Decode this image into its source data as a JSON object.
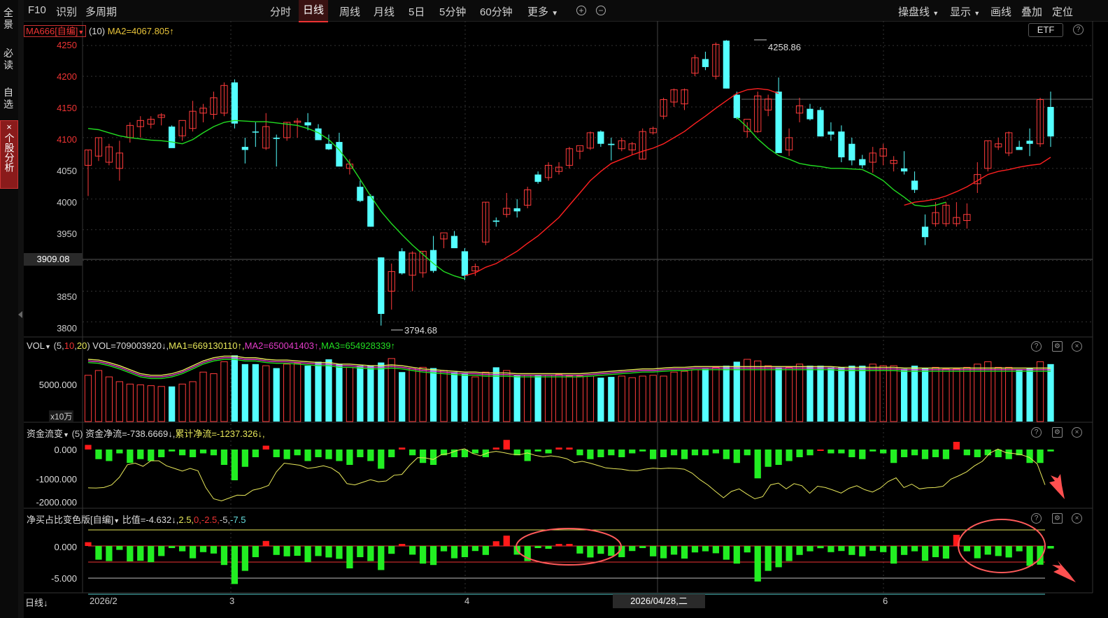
{
  "sidebar": {
    "items": [
      {
        "label": "全景"
      },
      {
        "label": "必读"
      },
      {
        "label": "自选"
      },
      {
        "label": "个股分析",
        "close": "×"
      }
    ]
  },
  "topbar": {
    "left_tabs": [
      "F10",
      "识别",
      "多周期"
    ],
    "period_tabs": [
      "分时",
      "日线",
      "周线",
      "月线",
      "5日",
      "5分钟",
      "60分钟",
      "更多"
    ],
    "active_period": "日线",
    "zoom_in": "+",
    "zoom_out": "−",
    "right_menu": [
      "操盘线",
      "显示",
      "画线",
      "叠加",
      "定位"
    ]
  },
  "main_panel": {
    "indicator_select": "MA666[自编]",
    "indicator_param": "(10)",
    "ma2_label": "MA2=4067.805↑",
    "etf_button": "ETF",
    "help": "?",
    "high_label": "4258.86",
    "low_label": "3794.68",
    "crosshair_price": "3909.08",
    "y_ticks": [
      "4250",
      "4200",
      "4150",
      "4100",
      "4050",
      "4000",
      "3950",
      "3850",
      "3800"
    ]
  },
  "vol_panel": {
    "title": "VOL",
    "params_open": "(",
    "p1": "5",
    ",": ",",
    "p2": "10",
    "p3": "20",
    "params_close": ")",
    "vol": "VOL=709003920↓,",
    "ma1": "MA1=669130110↑,",
    "ma2": "MA2=650041403↑,",
    "ma3": "MA3=654928339↑",
    "y_tick": "5000.000",
    "unit": "x10万"
  },
  "flow_panel": {
    "title": "资金流变",
    "param": "(5)",
    "net": "资金净流=-738.6669↓,",
    "cum": "累计净流=-1237.326↓,",
    "y_ticks": [
      "0.000",
      "-1000.000",
      "-2000.000"
    ]
  },
  "ratio_panel": {
    "title": "净买占比变色版[自编]",
    "ratio": "比值=-4.632↓,",
    "l1": "2.5,",
    "l2": "0,",
    "l3": "-2.5,",
    "l4": "-5,",
    "l5": "-7.5",
    "y_ticks": [
      "0.000",
      "-5.000"
    ]
  },
  "footer": {
    "period": "日线↓",
    "x_labels": [
      "2026/2",
      "3",
      "4",
      "6"
    ],
    "crosshair_date": "2026/04/28,二"
  },
  "colors": {
    "up": "#ff3b3b",
    "down": "#54ffff",
    "ma_green": "#22dd22",
    "ma_red": "#ff2020",
    "flow_pos": "#ff1a1a",
    "flow_neg": "#22ee22",
    "yellow": "#e8e85a"
  },
  "chart_data": {
    "type": "candlestick",
    "ylim": [
      3780,
      4265
    ],
    "candles": [
      {
        "o": 4055,
        "h": 4080,
        "l": 4005,
        "c": 4080
      },
      {
        "o": 4070,
        "h": 4100,
        "l": 4062,
        "c": 4100
      },
      {
        "o": 4060,
        "h": 4090,
        "l": 4055,
        "c": 4085
      },
      {
        "o": 4050,
        "h": 4095,
        "l": 4030,
        "c": 4075
      },
      {
        "o": 4100,
        "h": 4125,
        "l": 4092,
        "c": 4120
      },
      {
        "o": 4118,
        "h": 4135,
        "l": 4100,
        "c": 4128
      },
      {
        "o": 4122,
        "h": 4135,
        "l": 4115,
        "c": 4130
      },
      {
        "o": 4133,
        "h": 4140,
        "l": 4120,
        "c": 4137
      },
      {
        "o": 4118,
        "h": 4120,
        "l": 4090,
        "c": 4083
      },
      {
        "o": 4103,
        "h": 4118,
        "l": 4095,
        "c": 4128
      },
      {
        "o": 4115,
        "h": 4160,
        "l": 4110,
        "c": 4143
      },
      {
        "o": 4140,
        "h": 4155,
        "l": 4125,
        "c": 4148
      },
      {
        "o": 4138,
        "h": 4175,
        "l": 4130,
        "c": 4165
      },
      {
        "o": 4140,
        "h": 4190,
        "l": 4135,
        "c": 4185
      },
      {
        "o": 4190,
        "h": 4195,
        "l": 4115,
        "c": 4123
      },
      {
        "o": 4085,
        "h": 4100,
        "l": 4058,
        "c": 4080
      },
      {
        "o": 4110,
        "h": 4125,
        "l": 4085,
        "c": 4109
      },
      {
        "o": 4083,
        "h": 4140,
        "l": 4080,
        "c": 4118
      },
      {
        "o": 4100,
        "h": 4105,
        "l": 4053,
        "c": 4098
      },
      {
        "o": 4100,
        "h": 4125,
        "l": 4095,
        "c": 4125
      },
      {
        "o": 4125,
        "h": 4132,
        "l": 4100,
        "c": 4127
      },
      {
        "o": 4125,
        "h": 4140,
        "l": 4112,
        "c": 4120
      },
      {
        "o": 4115,
        "h": 4122,
        "l": 4100,
        "c": 4096
      },
      {
        "o": 4090,
        "h": 4105,
        "l": 4080,
        "c": 4081
      },
      {
        "o": 4093,
        "h": 4108,
        "l": 4055,
        "c": 4053
      },
      {
        "o": 4050,
        "h": 4065,
        "l": 4040,
        "c": 4057
      },
      {
        "o": 4020,
        "h": 4030,
        "l": 3995,
        "c": 3997
      },
      {
        "o": 4005,
        "h": 4008,
        "l": 3955,
        "c": 3955
      },
      {
        "o": 3905,
        "h": 3905,
        "l": 3794,
        "c": 3813
      },
      {
        "o": 3850,
        "h": 3895,
        "l": 3820,
        "c": 3882
      },
      {
        "o": 3915,
        "h": 3920,
        "l": 3877,
        "c": 3879
      },
      {
        "o": 3876,
        "h": 3915,
        "l": 3850,
        "c": 3912
      },
      {
        "o": 3880,
        "h": 3915,
        "l": 3872,
        "c": 3915
      },
      {
        "o": 3917,
        "h": 3940,
        "l": 3880,
        "c": 3883
      },
      {
        "o": 3935,
        "h": 3942,
        "l": 3920,
        "c": 3945
      },
      {
        "o": 3940,
        "h": 3948,
        "l": 3920,
        "c": 3920
      },
      {
        "o": 3915,
        "h": 3920,
        "l": 3868,
        "c": 3875
      },
      {
        "o": 3883,
        "h": 3895,
        "l": 3875,
        "c": 3890
      },
      {
        "o": 3930,
        "h": 3995,
        "l": 3925,
        "c": 3995
      },
      {
        "o": 3965,
        "h": 3970,
        "l": 3955,
        "c": 3963
      },
      {
        "o": 3975,
        "h": 4010,
        "l": 3970,
        "c": 3985
      },
      {
        "o": 3985,
        "h": 4000,
        "l": 3970,
        "c": 3980
      },
      {
        "o": 3990,
        "h": 4020,
        "l": 3985,
        "c": 4015
      },
      {
        "o": 4040,
        "h": 4045,
        "l": 4025,
        "c": 4028
      },
      {
        "o": 4035,
        "h": 4060,
        "l": 4030,
        "c": 4055
      },
      {
        "o": 4045,
        "h": 4060,
        "l": 4040,
        "c": 4052
      },
      {
        "o": 4055,
        "h": 4085,
        "l": 4050,
        "c": 4082
      },
      {
        "o": 4078,
        "h": 4085,
        "l": 4065,
        "c": 4087
      },
      {
        "o": 4083,
        "h": 4110,
        "l": 4080,
        "c": 4108
      },
      {
        "o": 4110,
        "h": 4112,
        "l": 4085,
        "c": 4090
      },
      {
        "o": 4090,
        "h": 4100,
        "l": 4063,
        "c": 4088
      },
      {
        "o": 4082,
        "h": 4100,
        "l": 4078,
        "c": 4095
      },
      {
        "o": 4080,
        "h": 4093,
        "l": 4072,
        "c": 4090
      },
      {
        "o": 4065,
        "h": 4115,
        "l": 4065,
        "c": 4110
      },
      {
        "o": 4108,
        "h": 4118,
        "l": 4105,
        "c": 4115
      },
      {
        "o": 4135,
        "h": 4165,
        "l": 4130,
        "c": 4162
      },
      {
        "o": 4158,
        "h": 4180,
        "l": 4150,
        "c": 4178
      },
      {
        "o": 4155,
        "h": 4180,
        "l": 4145,
        "c": 4178
      },
      {
        "o": 4205,
        "h": 4235,
        "l": 4200,
        "c": 4230
      },
      {
        "o": 4228,
        "h": 4240,
        "l": 4210,
        "c": 4215
      },
      {
        "o": 4200,
        "h": 4255,
        "l": 4195,
        "c": 4252
      },
      {
        "o": 4258,
        "h": 4259,
        "l": 4180,
        "c": 4180
      },
      {
        "o": 4170,
        "h": 4175,
        "l": 4130,
        "c": 4132
      },
      {
        "o": 4110,
        "h": 4125,
        "l": 4100,
        "c": 4130
      },
      {
        "o": 4110,
        "h": 4175,
        "l": 4108,
        "c": 4168
      },
      {
        "o": 4145,
        "h": 4170,
        "l": 4135,
        "c": 4163
      },
      {
        "o": 4175,
        "h": 4198,
        "l": 4075,
        "c": 4075
      },
      {
        "o": 4080,
        "h": 4115,
        "l": 4070,
        "c": 4100
      },
      {
        "o": 4140,
        "h": 4165,
        "l": 4125,
        "c": 4152
      },
      {
        "o": 4147,
        "h": 4155,
        "l": 4128,
        "c": 4130
      },
      {
        "o": 4145,
        "h": 4150,
        "l": 4102,
        "c": 4102
      },
      {
        "o": 4110,
        "h": 4125,
        "l": 4095,
        "c": 4105
      },
      {
        "o": 4110,
        "h": 4120,
        "l": 4060,
        "c": 4068
      },
      {
        "o": 4090,
        "h": 4100,
        "l": 4055,
        "c": 4063
      },
      {
        "o": 4065,
        "h": 4072,
        "l": 4050,
        "c": 4055
      },
      {
        "o": 4060,
        "h": 4085,
        "l": 4043,
        "c": 4075
      },
      {
        "o": 4070,
        "h": 4090,
        "l": 4055,
        "c": 4082
      },
      {
        "o": 4058,
        "h": 4070,
        "l": 4045,
        "c": 4063
      },
      {
        "o": 4050,
        "h": 4078,
        "l": 4040,
        "c": 4045
      },
      {
        "o": 4030,
        "h": 4045,
        "l": 4010,
        "c": 4015
      },
      {
        "o": 3955,
        "h": 3975,
        "l": 3925,
        "c": 3938
      },
      {
        "o": 3960,
        "h": 3995,
        "l": 3955,
        "c": 3978
      },
      {
        "o": 3960,
        "h": 3995,
        "l": 3955,
        "c": 3990
      },
      {
        "o": 3960,
        "h": 3995,
        "l": 3955,
        "c": 3970
      },
      {
        "o": 3965,
        "h": 3993,
        "l": 3952,
        "c": 3975
      },
      {
        "o": 4025,
        "h": 4060,
        "l": 4010,
        "c": 4040
      },
      {
        "o": 4050,
        "h": 4095,
        "l": 4045,
        "c": 4095
      },
      {
        "o": 4085,
        "h": 4100,
        "l": 4080,
        "c": 4090
      },
      {
        "o": 4075,
        "h": 4110,
        "l": 4070,
        "c": 4108
      },
      {
        "o": 4085,
        "h": 4095,
        "l": 4080,
        "c": 4080
      },
      {
        "o": 4095,
        "h": 4115,
        "l": 4070,
        "c": 4090
      },
      {
        "o": 4090,
        "h": 4165,
        "l": 4085,
        "c": 4162
      },
      {
        "o": 4150,
        "h": 4175,
        "l": 4085,
        "c": 4102
      }
    ],
    "ma_green": [
      4115,
      4113,
      4108,
      4103,
      4100,
      4098,
      4096,
      4095,
      4093,
      4090,
      4097,
      4108,
      4118,
      4125,
      4128,
      4127,
      4126,
      4126,
      4124,
      4122,
      4120,
      4115,
      4108,
      4097,
      4080,
      4058,
      4032,
      4005,
      3980,
      3960,
      3942,
      3925,
      3910,
      3895,
      3882,
      3875,
      3870
    ],
    "ma_green2": [
      4133,
      4117,
      4098,
      4083,
      4071,
      4065,
      4058,
      4055,
      4053,
      4050,
      4050,
      4049,
      4048,
      4040,
      4030,
      4015,
      4003,
      3990,
      3988,
      3990,
      3995
    ],
    "ma_red": [
      4070,
      4075,
      4080,
      4088,
      4095,
      4103,
      4112,
      4118,
      4125,
      4126,
      4130,
      4133,
      4128,
      3875,
      3880,
      3889,
      3895,
      3905,
      3915,
      3928,
      3940,
      3955,
      3970,
      3990,
      4010,
      4030,
      4045,
      4058,
      4065,
      4072,
      4078,
      4083,
      4090,
      4100,
      4110,
      4123,
      4135,
      4148,
      4160,
      4172,
      4178,
      4180,
      4178,
      4172
    ],
    "ma_red2": [
      3990,
      3995,
      3997,
      4000,
      4005,
      4012,
      4020,
      4030,
      4040,
      4045,
      4048,
      4052,
      4055,
      4057,
      4068
    ],
    "volume": [
      58,
      64,
      56,
      50,
      47,
      46,
      45,
      44,
      44,
      47,
      50,
      62,
      60,
      75,
      83,
      72,
      72,
      70,
      67,
      72,
      73,
      70,
      75,
      78,
      72,
      68,
      70,
      70,
      74,
      79,
      62,
      66,
      68,
      67,
      64,
      62,
      61,
      56,
      62,
      68,
      64,
      58,
      58,
      58,
      58,
      59,
      57,
      57,
      57,
      55,
      56,
      57,
      55,
      57,
      58,
      57,
      62,
      63,
      65,
      66,
      68,
      70,
      75,
      78,
      76,
      70,
      68,
      68,
      72,
      70,
      70,
      68,
      68,
      70,
      70,
      72,
      70,
      70,
      66,
      70,
      67,
      68,
      66,
      66,
      68,
      72,
      75,
      68,
      68,
      65,
      67,
      75,
      72
    ],
    "volume_ma": [
      78,
      77,
      74,
      70,
      65,
      60,
      58,
      58,
      60,
      64,
      70,
      76,
      80,
      82,
      82,
      80,
      80,
      78,
      77,
      77,
      76,
      75,
      74,
      74,
      72,
      72,
      71,
      70,
      70,
      71,
      70,
      68,
      66,
      65,
      64,
      63,
      62,
      62,
      61,
      61,
      61,
      60,
      60,
      60,
      60,
      60,
      60,
      60,
      61,
      62,
      63,
      64,
      65,
      66,
      66,
      67,
      68,
      68,
      69,
      69,
      69,
      69,
      69,
      69,
      69,
      69,
      69,
      69,
      69,
      69,
      69,
      69,
      68,
      68,
      68,
      68,
      68,
      68,
      67,
      67,
      67,
      67,
      67,
      67,
      67,
      67,
      67,
      67,
      67,
      67,
      67,
      67,
      67
    ],
    "flow": [
      12,
      -25,
      -30,
      -10,
      -35,
      -25,
      -30,
      -20,
      -5,
      -15,
      -20,
      -10,
      -15,
      -40,
      -80,
      -45,
      -20,
      10,
      -20,
      -25,
      -15,
      -30,
      -20,
      -25,
      -30,
      -40,
      -20,
      -30,
      -50,
      -20,
      5,
      -15,
      -35,
      -40,
      -15,
      -20,
      -20,
      -10,
      -20,
      5,
      25,
      -15,
      -30,
      -5,
      -10,
      5,
      5,
      -15,
      -25,
      -20,
      -15,
      -20,
      -10,
      -5,
      -25,
      -20,
      -15,
      -25,
      -15,
      -15,
      -10,
      -25,
      -35,
      -15,
      -75,
      -45,
      -40,
      -30,
      -20,
      -15,
      0,
      -10,
      -10,
      -20,
      -25,
      -5,
      -10,
      -35,
      -20,
      -15,
      -25,
      -20,
      -25,
      20,
      -15,
      -20,
      -15,
      -20,
      -25,
      -15,
      -35,
      -35,
      -5,
      15,
      -15,
      -20,
      -10,
      -5,
      -30,
      -45
    ],
    "flow_cum": [
      -1460,
      -1470,
      -1450,
      -1350,
      -1050,
      -580,
      -520,
      -640,
      -430,
      -430,
      -620,
      -720,
      -820,
      -720,
      -810,
      -1450,
      -1880,
      -1960,
      -1850,
      -1740,
      -1750,
      -1550,
      -1480,
      -1370,
      -850,
      -520,
      -560,
      -600,
      -720,
      -680,
      -620,
      -700,
      -900,
      -1300,
      -1350,
      -1250,
      -1150,
      -1230,
      -1200,
      -980,
      -950,
      -600,
      -310,
      -320,
      -380,
      -200,
      -150,
      -40,
      30,
      -150,
      -240,
      -120,
      -70,
      -120,
      -180,
      -200,
      -130,
      -220,
      -280,
      -240,
      -280,
      -350,
      -500,
      -450,
      -520,
      -610,
      -700,
      -730,
      -750,
      -800,
      -810,
      -750,
      -710,
      -730,
      -710,
      -720,
      -750,
      -900,
      -1150,
      -1350,
      -1600,
      -1840,
      -1600,
      -1500,
      -1700,
      -1880,
      -1800,
      -1350,
      -1280,
      -1500,
      -1300,
      -1380,
      -1670,
      -1400,
      -1450,
      -1550,
      -1660,
      -1480,
      -1380,
      -1530,
      -1620,
      -1470,
      -1220,
      -1080,
      -1450,
      -1320,
      -1500,
      -1460,
      -1450,
      -1400,
      -1130,
      -1000,
      -850,
      -620,
      -450,
      -130,
      20,
      -120,
      -150,
      -200,
      -300,
      -550,
      -1350
    ]
  }
}
